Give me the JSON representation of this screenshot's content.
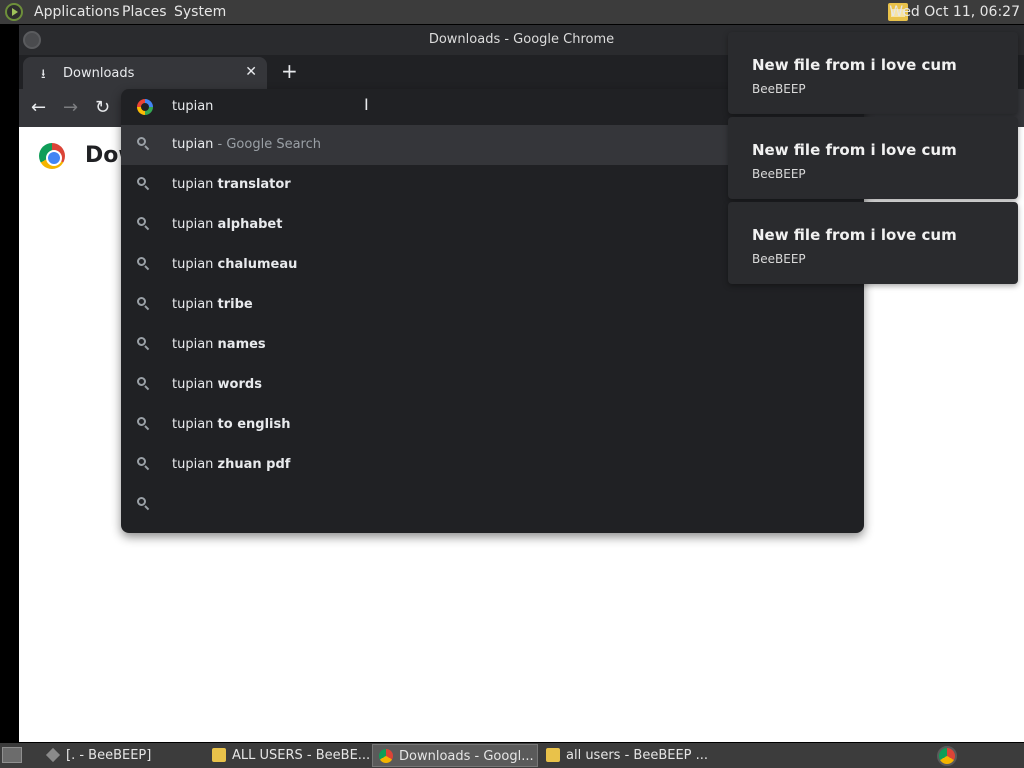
{
  "top_panel": {
    "menus": [
      "Applications",
      "Places",
      "System"
    ],
    "clock": "Wed Oct 11, 06:27"
  },
  "window": {
    "title": "Downloads - Google Chrome"
  },
  "tab": {
    "label": "Downloads",
    "close_glyph": "✕",
    "new_tab_glyph": "+"
  },
  "toolbar": {
    "back_glyph": "←",
    "forward_glyph": "→",
    "reload_glyph": "↻"
  },
  "page": {
    "title": "Downloads"
  },
  "omnibox": {
    "input_text": "tupian",
    "suggestions": [
      {
        "prefix": "tupian",
        "suffix": "",
        "note": " - Google Search"
      },
      {
        "prefix": "tupian ",
        "suffix": "translator",
        "note": ""
      },
      {
        "prefix": "tupian ",
        "suffix": "alphabet",
        "note": ""
      },
      {
        "prefix": "tupian ",
        "suffix": "chalumeau",
        "note": ""
      },
      {
        "prefix": "tupian ",
        "suffix": "tribe",
        "note": ""
      },
      {
        "prefix": "tupian ",
        "suffix": "names",
        "note": ""
      },
      {
        "prefix": "tupian ",
        "suffix": "words",
        "note": ""
      },
      {
        "prefix": "tupian ",
        "suffix": "to english",
        "note": ""
      },
      {
        "prefix": "tupian ",
        "suffix": "zhuan pdf",
        "note": ""
      },
      {
        "prefix": "",
        "suffix": "",
        "note": ""
      }
    ]
  },
  "notifications": [
    {
      "title": "New file from i love cum",
      "body": "BeeBEEP"
    },
    {
      "title": "New file from i love cum",
      "body": "BeeBEEP"
    },
    {
      "title": "New file from i love cum",
      "body": "BeeBEEP"
    }
  ],
  "taskbar": {
    "tasks": [
      {
        "label": "[. - BeeBEEP]",
        "icon": "tool-icon"
      },
      {
        "label": "ALL USERS - BeeBE...",
        "icon": "beebeep-icon"
      },
      {
        "label": "Downloads - Googl...",
        "icon": "chrome-icon"
      },
      {
        "label": "all users - BeeBEEP ...",
        "icon": "beebeep-icon"
      }
    ]
  },
  "colors": {
    "omnibox_bg": "#202124",
    "selected_row": "#35363a",
    "panel_bg": "#3c3c3c"
  }
}
